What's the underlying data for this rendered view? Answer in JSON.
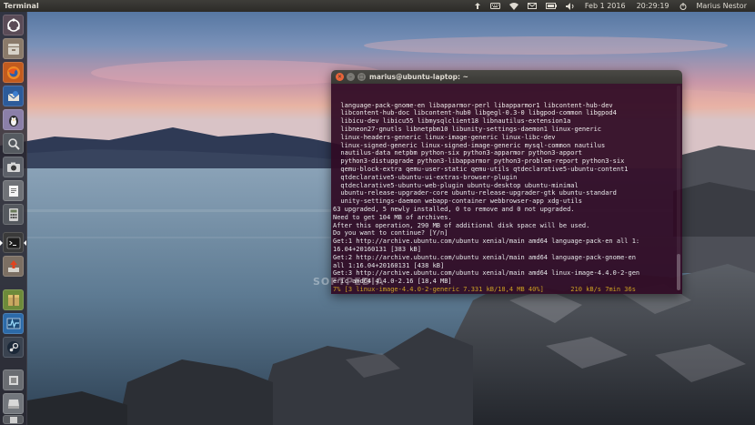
{
  "top_panel": {
    "app_title": "Terminal",
    "date": "Feb 1 2016",
    "time": "20:29:19",
    "user": "Marius Nestor",
    "icons": [
      "network-upload-icon",
      "keyboard-icon",
      "wifi-icon",
      "mail-icon",
      "battery-icon",
      "volume-icon"
    ]
  },
  "launcher": {
    "items": [
      {
        "name": "dash-home",
        "icon": "ubuntu-logo-icon"
      },
      {
        "name": "files",
        "icon": "file-cabinet-icon"
      },
      {
        "name": "firefox",
        "icon": "firefox-icon"
      },
      {
        "name": "thunderbird",
        "icon": "thunderbird-icon"
      },
      {
        "name": "pidgin",
        "icon": "penguin-icon"
      },
      {
        "name": "screenshot",
        "icon": "magnifier-icon"
      },
      {
        "name": "camera",
        "icon": "camera-icon"
      },
      {
        "name": "text-editor",
        "icon": "text-editor-icon"
      },
      {
        "name": "calculator",
        "icon": "calculator-icon"
      },
      {
        "name": "terminal",
        "icon": "terminal-icon"
      },
      {
        "name": "software-updater",
        "icon": "updater-icon"
      },
      {
        "name": "archive-manager",
        "icon": "archive-icon"
      },
      {
        "name": "system-monitor",
        "icon": "system-monitor-icon"
      },
      {
        "name": "steam",
        "icon": "steam-icon"
      },
      {
        "name": "settings",
        "icon": "settings-icon"
      },
      {
        "name": "device",
        "icon": "drive-icon"
      },
      {
        "name": "trash",
        "icon": "trash-icon"
      }
    ]
  },
  "terminal": {
    "title": "marius@ubuntu-laptop: ~",
    "lines": [
      "  language-pack-gnome-en libapparmor-perl libapparmor1 libcontent-hub-dev",
      "  libcontent-hub-doc libcontent-hub0 libgegl-0.3-0 libgpod-common libgpod4",
      "  libicu-dev libicu55 libmysqlclient18 libnautilus-extension1a",
      "  libneon27-gnutls libnetpbm10 libunity-settings-daemon1 linux-generic",
      "  linux-headers-generic linux-image-generic linux-libc-dev",
      "  linux-signed-generic linux-signed-image-generic mysql-common nautilus",
      "  nautilus-data netpbm python-six python3-apparmor python3-apport",
      "  python3-distupgrade python3-libapparmor python3-problem-report python3-six",
      "  qemu-block-extra qemu-user-static qemu-utils qtdeclarative5-ubuntu-content1",
      "  qtdeclarative5-ubuntu-ui-extras-browser-plugin",
      "  qtdeclarative5-ubuntu-web-plugin ubuntu-desktop ubuntu-minimal",
      "  ubuntu-release-upgrader-core ubuntu-release-upgrader-gtk ubuntu-standard",
      "  unity-settings-daemon webapp-container webbrowser-app xdg-utils",
      "63 upgraded, 5 newly installed, 0 to remove and 0 not upgraded.",
      "Need to get 104 MB of archives.",
      "After this operation, 290 MB of additional disk space will be used.",
      "Do you want to continue? [Y/n]",
      "Get:1 http://archive.ubuntu.com/ubuntu xenial/main amd64 language-pack-en all 1:",
      "16.04+20160131 [383 kB]",
      "Get:2 http://archive.ubuntu.com/ubuntu xenial/main amd64 language-pack-gnome-en",
      "all 1:16.04+20160131 [438 kB]",
      "Get:3 http://archive.ubuntu.com/ubuntu xenial/main amd64 linux-image-4.4.0-2-gen",
      "eric amd64 4.4.0-2.16 [18,4 MB]",
      "7% [3 linux-image-4.4.0-2-generic 7.331 kB/18,4 MB 40%]       210 kB/s 7min 36s"
    ]
  },
  "watermark": "SOFTPEDIA",
  "colors": {
    "terminal_bg": "#300a24",
    "progress_text": "#d6a61d",
    "panel_bg": "#2c2b28",
    "close_button": "#e9643a"
  }
}
